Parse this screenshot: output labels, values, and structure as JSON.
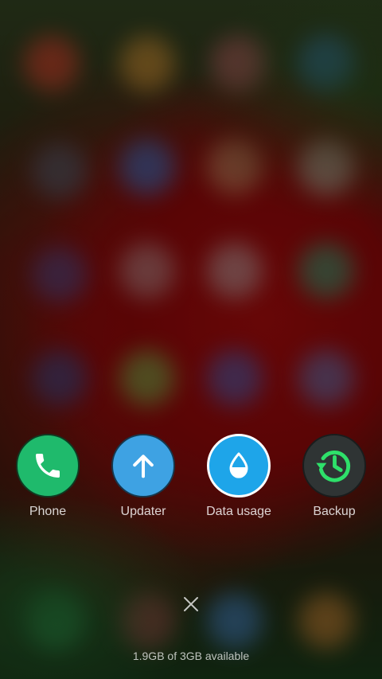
{
  "shortcuts": [
    {
      "label": "Phone",
      "icon": "phone-icon",
      "color": "#1fba6c"
    },
    {
      "label": "Updater",
      "icon": "arrow-up-icon",
      "color": "#3ea2e3"
    },
    {
      "label": "Data usage",
      "icon": "water-drop-icon",
      "color": "#1ea5e9"
    },
    {
      "label": "Backup",
      "icon": "backup-clock-icon",
      "color": "#2f3434",
      "accent": "#2ee06a"
    }
  ],
  "close": {
    "icon": "close-icon"
  },
  "memory_status": "1.9GB of 3GB available"
}
